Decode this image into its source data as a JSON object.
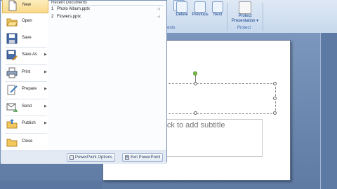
{
  "ribbon": {
    "buttons": [
      {
        "label": "Delete",
        "icon": "delete-comment-icon"
      },
      {
        "label": "Previous",
        "icon": "previous-comment-icon"
      },
      {
        "label": "Next",
        "icon": "next-comment-icon"
      },
      {
        "label": "Protect Presentation ▾",
        "icon": "protect-presentation-icon"
      }
    ],
    "groups": [
      {
        "label": "ents"
      },
      {
        "label": "Protect"
      }
    ]
  },
  "office_menu": {
    "items": [
      {
        "label": "New",
        "icon": "new-document-icon",
        "submenu": false
      },
      {
        "label": "Open",
        "icon": "open-folder-icon",
        "submenu": false
      },
      {
        "label": "Save",
        "icon": "save-disk-icon",
        "submenu": false
      },
      {
        "label": "Save As",
        "icon": "save-as-icon",
        "submenu": true
      },
      {
        "label": "Print",
        "icon": "printer-icon",
        "submenu": true
      },
      {
        "label": "Prepare",
        "icon": "prepare-icon",
        "submenu": true
      },
      {
        "label": "Send",
        "icon": "send-icon",
        "submenu": true
      },
      {
        "label": "Publish",
        "icon": "publish-icon",
        "submenu": true
      },
      {
        "label": "Close",
        "icon": "close-folder-icon",
        "submenu": false
      }
    ],
    "recent_header": "Recent Documents",
    "recent_documents": [
      {
        "num": "1",
        "name": "Photo Album.pptx"
      },
      {
        "num": "2",
        "name": "Flowers.pptx"
      }
    ],
    "options_button": "PowerPoint Options",
    "exit_button": "Exit PowerPoint"
  },
  "slide": {
    "subtitle_placeholder": "lick to add subtitle"
  },
  "colors": {
    "workspace": "#6c87ad",
    "ribbon": "#dfe9f5",
    "menu_highlight": "#f9d98a"
  }
}
